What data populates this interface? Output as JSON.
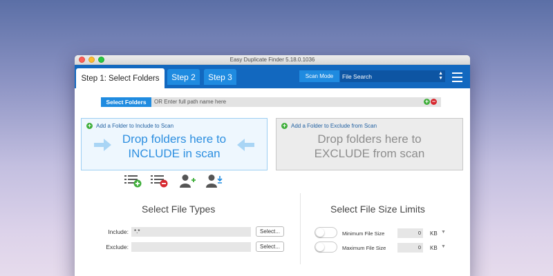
{
  "window": {
    "title": "Easy Duplicate Finder 5.18.0.1036"
  },
  "tabs": {
    "step1_prefix": "Step 1:",
    "step1_label": "Select Folders",
    "step2_label": "Step 2",
    "step3_label": "Step 3"
  },
  "scan_mode": {
    "label": "Scan Mode",
    "value": "File Search"
  },
  "path_bar": {
    "button_label": "Select Folders",
    "placeholder": "OR Enter full path name here"
  },
  "include_box": {
    "header": "Add a Folder to Include to Scan",
    "line1": "Drop folders here to",
    "line2": "INCLUDE in scan"
  },
  "exclude_box": {
    "header": "Add a Folder to Exclude from Scan",
    "line1": "Drop folders here to",
    "line2": "EXCLUDE from scan"
  },
  "toolbar_icons": [
    "add-list-icon",
    "remove-list-icon",
    "add-user-icon",
    "download-user-icon"
  ],
  "file_types": {
    "title": "Select File Types",
    "include_label": "Include:",
    "include_value": "*.*",
    "exclude_label": "Exclude:",
    "exclude_value": "",
    "select_button": "Select..."
  },
  "file_size": {
    "title": "Select File Size Limits",
    "min_label": "Minimum File Size",
    "min_value": "0",
    "max_label": "Maximum File Size",
    "max_value": "0",
    "unit": "KB"
  },
  "colors": {
    "header_blue": "#1268bf",
    "tab_blue": "#1f8be0",
    "include_text": "#2d8fe0",
    "add_green": "#3fae3a",
    "remove_red": "#d7282f"
  }
}
